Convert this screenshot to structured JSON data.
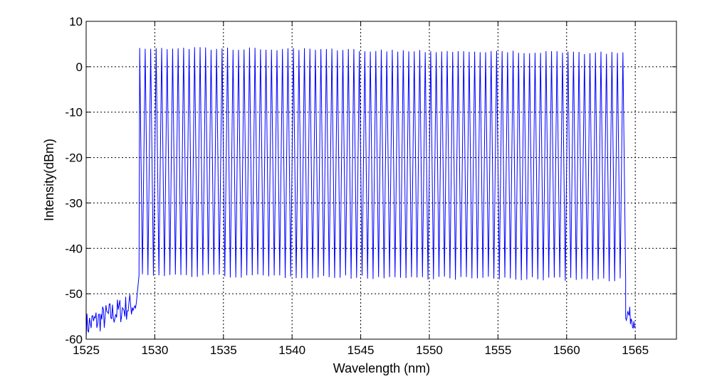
{
  "chart_data": {
    "type": "line",
    "xlabel": "Wavelength (nm)",
    "ylabel": "Intensity(dBm)",
    "xlim": [
      1525,
      1568
    ],
    "ylim": [
      -60,
      10
    ],
    "xticks": [
      1525,
      1530,
      1535,
      1540,
      1545,
      1550,
      1555,
      1560,
      1565
    ],
    "yticks": [
      -60,
      -50,
      -40,
      -30,
      -20,
      -10,
      0,
      10
    ],
    "xtick_labels": [
      "1525",
      "1530",
      "1535",
      "1540",
      "1545",
      "1550",
      "1555",
      "1560",
      "1565"
    ],
    "ytick_labels": [
      "-60",
      "-50",
      "-40",
      "-30",
      "-20",
      "-10",
      "0",
      "10"
    ],
    "grid": true,
    "grid_style": "dotted",
    "line_color": "#0000ff",
    "series": [
      {
        "comb": {
          "start": 1528.9,
          "end": 1564.0,
          "spacing": 0.4,
          "peak_dbm": [
            4.5,
            3.3
          ],
          "valley_dbm": [
            -45.5,
            -46.5
          ]
        },
        "noise_floor": {
          "left_range": [
            1525.0,
            1528.7
          ],
          "left_level_dbm": [
            -57,
            -52
          ],
          "right_range": [
            1564.3,
            1565.0
          ],
          "right_level_dbm": [
            -54,
            -56
          ]
        }
      }
    ]
  }
}
